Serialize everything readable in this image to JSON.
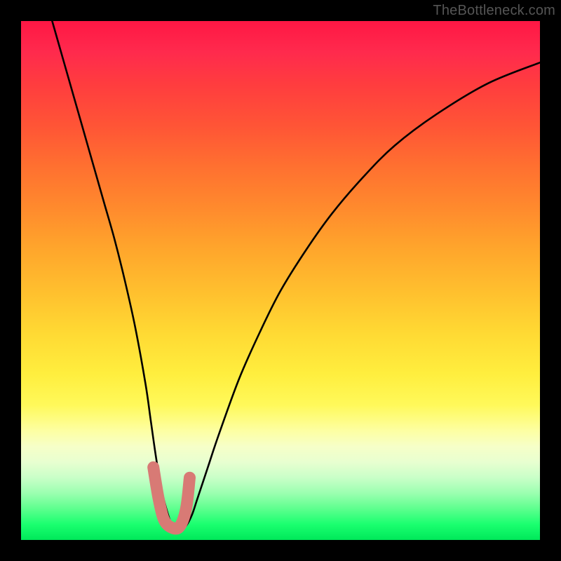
{
  "watermark": "TheBottleneck.com",
  "colors": {
    "page_bg": "#000000",
    "watermark": "#555555",
    "curve_stroke": "#000000",
    "marker_stroke": "#d87a75",
    "gradient_top": "#ff1744",
    "gradient_bottom": "#00e85a"
  },
  "chart_data": {
    "type": "line",
    "title": "",
    "xlabel": "",
    "ylabel": "",
    "xlim": [
      0,
      100
    ],
    "ylim": [
      0,
      100
    ],
    "grid": false,
    "legend": false,
    "series": [
      {
        "name": "bottleneck-curve",
        "x": [
          6,
          8,
          10,
          12,
          14,
          16,
          18,
          20,
          22,
          24,
          25,
          26,
          27,
          28,
          29,
          30,
          31,
          32,
          33,
          34,
          36,
          38,
          42,
          46,
          50,
          55,
          60,
          66,
          72,
          80,
          90,
          100
        ],
        "y": [
          100,
          93,
          86,
          79,
          72,
          65,
          58,
          50,
          41,
          30,
          23,
          16,
          10,
          6,
          3,
          2,
          2,
          3,
          5,
          8,
          14,
          20,
          31,
          40,
          48,
          56,
          63,
          70,
          76,
          82,
          88,
          92
        ]
      },
      {
        "name": "highlight-region",
        "x": [
          25.5,
          26.5,
          27.5,
          28.8,
          30.5,
          31.8,
          32.5
        ],
        "y": [
          14,
          8,
          4,
          2.5,
          2.5,
          6,
          12
        ]
      }
    ],
    "annotations": []
  }
}
